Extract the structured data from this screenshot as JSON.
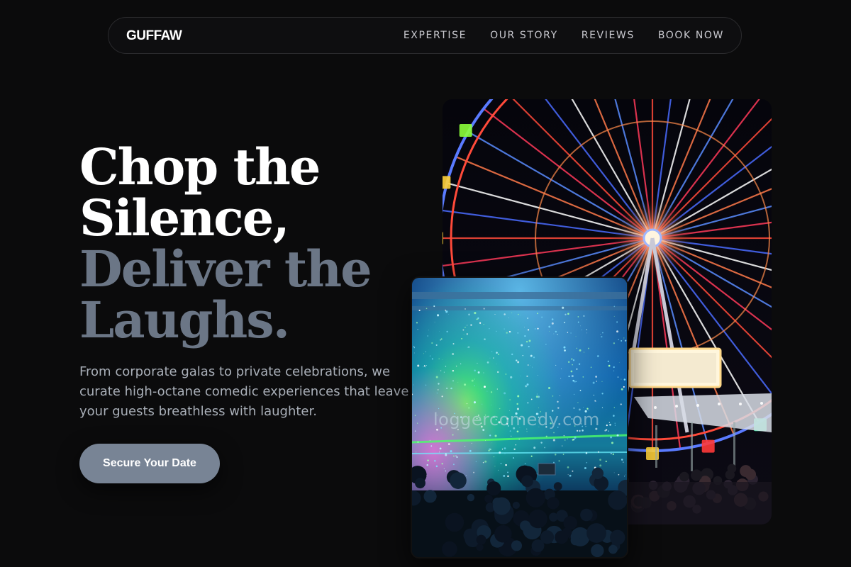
{
  "nav": {
    "brand": "GUFFAW",
    "links": [
      "EXPERTISE",
      "OUR STORY",
      "REVIEWS",
      "BOOK NOW"
    ]
  },
  "hero": {
    "title_line1": "Chop the",
    "title_line2": "Silence,",
    "title_line3": "Deliver the",
    "title_line4": "Laughs.",
    "subtitle": "From corporate galas to private celebrations, we curate high-octane comedic experiences that leave your guests breathless with laughter.",
    "cta_label": "Secure Your Date"
  },
  "images": {
    "ferris_wheel": "ferris-wheel-photo",
    "concert": "concert-crowd-photo",
    "watermark": "loggercomedy.com"
  },
  "colors": {
    "background": "#0b0b0c",
    "title_primary": "#ffffff",
    "title_accent": "#6b7686",
    "cta_bg": "#788495"
  }
}
